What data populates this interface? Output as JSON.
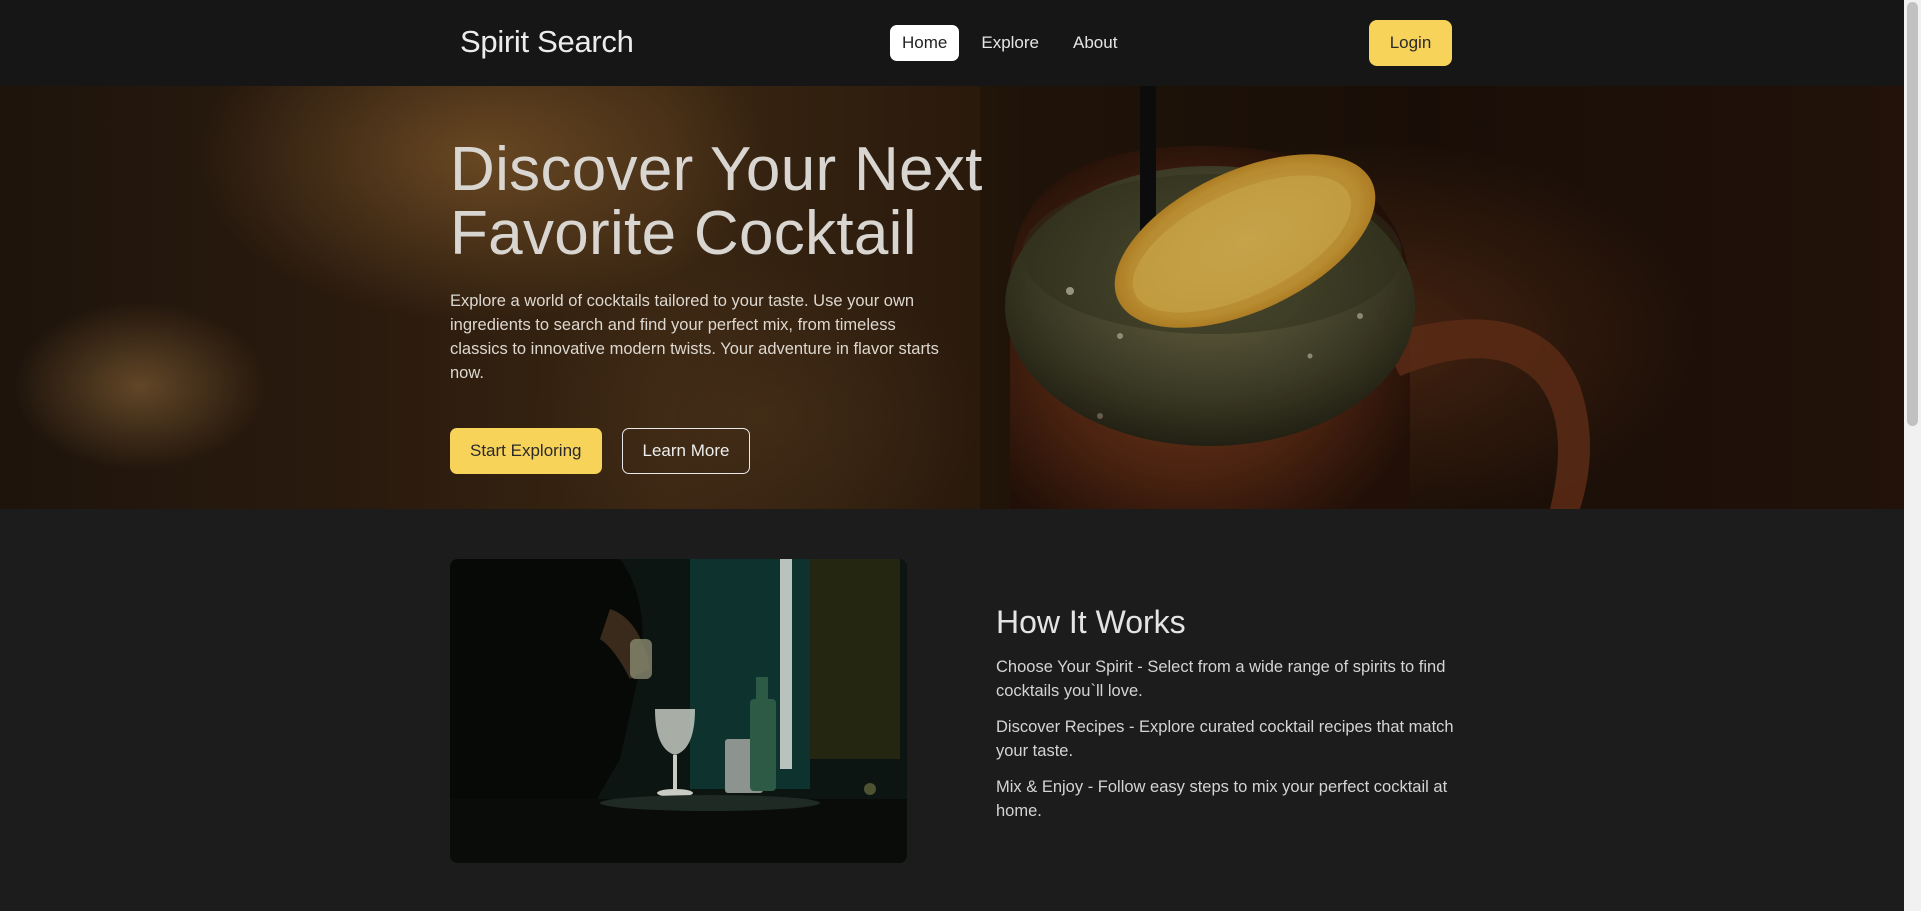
{
  "nav": {
    "brand": "Spirit Search",
    "links": [
      {
        "label": "Home",
        "active": true
      },
      {
        "label": "Explore",
        "active": false
      },
      {
        "label": "About",
        "active": false
      }
    ],
    "login": "Login"
  },
  "hero": {
    "title": "Discover Your Next Favorite Cocktail",
    "text": "Explore a world of cocktails tailored to your taste. Use your own ingredients to search and find your perfect mix, from timeless classics to innovative modern twists. Your adventure in flavor starts now.",
    "primary_button": "Start Exploring",
    "secondary_button": "Learn More"
  },
  "how": {
    "title": "How It Works",
    "steps": [
      "Choose Your Spirit - Select from a wide range of spirits to find cocktails you`ll love.",
      "Discover Recipes - Explore curated cocktail recipes that match your taste.",
      "Mix & Enjoy - Follow easy steps to mix your perfect cocktail at home."
    ]
  },
  "colors": {
    "accent": "#f7d35a",
    "navbar": "#161616",
    "background": "#1c1c1c"
  }
}
